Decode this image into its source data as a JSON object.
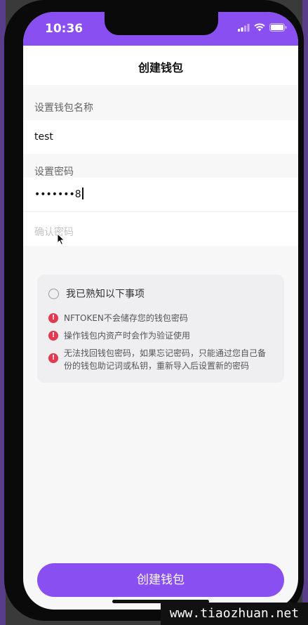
{
  "status_bar": {
    "time": "10:36"
  },
  "nav": {
    "title": "创建钱包"
  },
  "form": {
    "wallet_name_label": "设置钱包名称",
    "wallet_name_value": "test",
    "password_label": "设置密码",
    "password_value": "•••••••8",
    "confirm_placeholder": "确认密码"
  },
  "notice": {
    "ack_label": "我已熟知以下事项",
    "items": [
      "NFTOKEN不会储存您的钱包密码",
      "操作钱包内资产时会作为验证使用",
      "无法找回钱包密码，如果忘记密码，只能通过您自己备份的钱包助记词或私钥，重新导入后设置新的密码"
    ]
  },
  "footer": {
    "create_label": "创建钱包"
  },
  "watermark": "www.tiaozhuan.net",
  "colors": {
    "accent": "#8a4ff0",
    "warning": "#e5394f"
  },
  "icons": [
    "wifi-icon",
    "battery-icon",
    "signal-icon",
    "warning-icon",
    "radio-icon",
    "cursor-icon"
  ]
}
